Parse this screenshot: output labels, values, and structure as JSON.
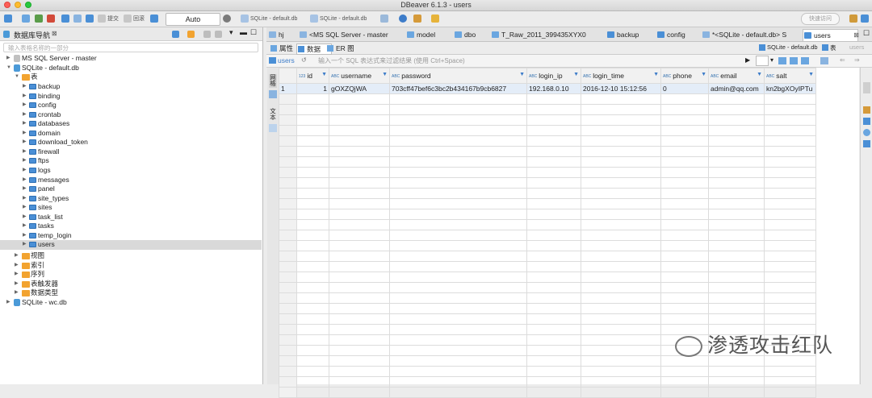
{
  "window": {
    "title": "DBeaver 6.1.3 - users"
  },
  "toolbar": {
    "transaction_mode": "Auto",
    "commit_label": "提交",
    "rollback_label": "回滚",
    "active_connection": "SQLite - default.db",
    "active_database": "SQLite - default.db",
    "quick_access": "快速访问"
  },
  "navigator": {
    "title": "数据库导航",
    "filter_placeholder": "输入表格名称的一部分",
    "connections": [
      {
        "label": "MS SQL Server - master"
      },
      {
        "label": "SQLite - default.db"
      },
      {
        "label": "SQLite - wc.db"
      }
    ],
    "tables_folder": "表",
    "tables": [
      "backup",
      "binding",
      "config",
      "crontab",
      "databases",
      "domain",
      "download_token",
      "firewall",
      "ftps",
      "logs",
      "messages",
      "panel",
      "site_types",
      "sites",
      "task_list",
      "tasks",
      "temp_login",
      "users"
    ],
    "folders": [
      "视图",
      "索引",
      "序列",
      "表触发器",
      "数据类型"
    ]
  },
  "editor_tabs": [
    {
      "label": "hj"
    },
    {
      "label": "<MS SQL Server - master"
    },
    {
      "label": "model"
    },
    {
      "label": "dbo"
    },
    {
      "label": "T_Raw_2011_399435XYX0"
    },
    {
      "label": "backup"
    },
    {
      "label": "config"
    },
    {
      "label": "*<SQLite - default.db> S"
    },
    {
      "label": "users"
    }
  ],
  "sub_tabs": {
    "properties": "属性",
    "data": "数据",
    "er": "ER 图"
  },
  "breadcrumb": {
    "connection": "SQLite - default.db",
    "type": "表",
    "table": "users"
  },
  "filter": {
    "table": "users",
    "placeholder": "输入一个 SQL 表达式来过滤结果 (使用 Ctrl+Space)"
  },
  "side_tabs": {
    "grid": "网格",
    "text": "文本"
  },
  "grid": {
    "columns": [
      {
        "name": "id",
        "type": "123"
      },
      {
        "name": "username",
        "type": "ABC"
      },
      {
        "name": "password",
        "type": "ABC"
      },
      {
        "name": "login_ip",
        "type": "ABC"
      },
      {
        "name": "login_time",
        "type": "ABC"
      },
      {
        "name": "phone",
        "type": "ABC"
      },
      {
        "name": "email",
        "type": "ABC"
      },
      {
        "name": "salt",
        "type": "ABC"
      }
    ],
    "rows": [
      {
        "num": "1",
        "id": "1",
        "username": "gOXZQjWA",
        "password": "703cff47bef6c3bc2b434167b9cb6827",
        "login_ip": "192.168.0.10",
        "login_time": "2016-12-10 15:12:56",
        "phone": "0",
        "email": "admin@qq.com",
        "salt": "kn2bgXOyIPTu"
      }
    ]
  },
  "watermark": "渗透攻击红队",
  "colors": {
    "accent": "#3d7cc9",
    "folder": "#f2a330",
    "table_icon": "#4a8fd6",
    "selection": "#e4edf8"
  }
}
